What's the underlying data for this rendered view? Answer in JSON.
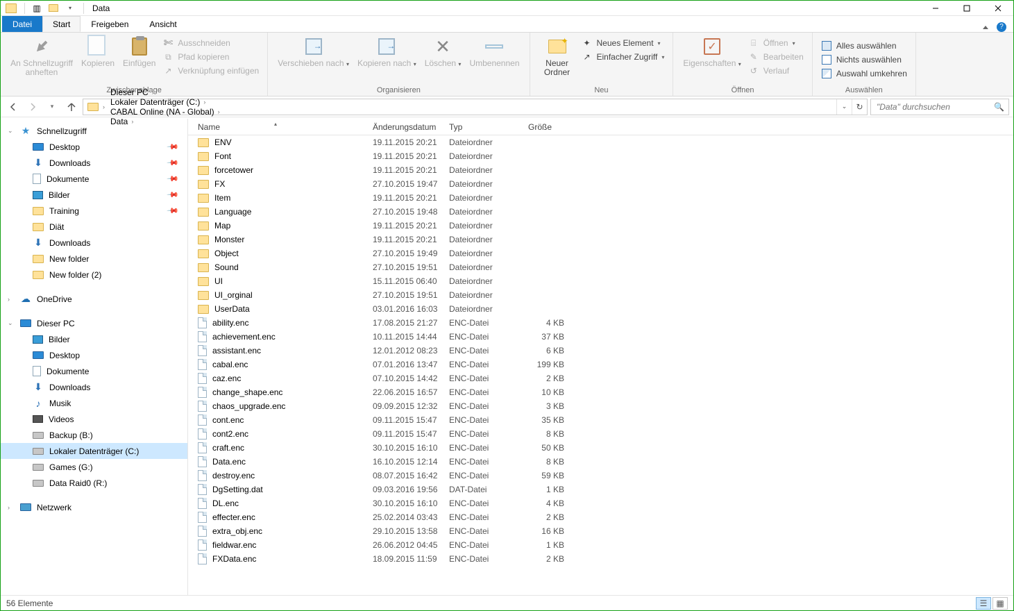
{
  "window": {
    "title": "Data"
  },
  "tabs": {
    "datei": "Datei",
    "start": "Start",
    "freigeben": "Freigeben",
    "ansicht": "Ansicht"
  },
  "ribbon": {
    "clipboard": {
      "pin": "An Schnellzugriff anheften",
      "copy": "Kopieren",
      "paste": "Einfügen",
      "cut": "Ausschneiden",
      "copypath": "Pfad kopieren",
      "pastelink": "Verknüpfung einfügen",
      "group": "Zwischenablage"
    },
    "organize": {
      "moveto": "Verschieben nach",
      "copyto": "Kopieren nach",
      "delete": "Löschen",
      "rename": "Umbenennen",
      "group": "Organisieren"
    },
    "new": {
      "newfolder": "Neuer Ordner",
      "newitem": "Neues Element",
      "easyaccess": "Einfacher Zugriff",
      "group": "Neu"
    },
    "open": {
      "properties": "Eigenschaften",
      "open": "Öffnen",
      "edit": "Bearbeiten",
      "history": "Verlauf",
      "group": "Öffnen"
    },
    "select": {
      "selectall": "Alles auswählen",
      "selectnone": "Nichts auswählen",
      "invert": "Auswahl umkehren",
      "group": "Auswählen"
    }
  },
  "breadcrumb": [
    "Dieser PC",
    "Lokaler Datenträger (C:)",
    "CABAL Online (NA - Global)",
    "Data"
  ],
  "search_placeholder": "\"Data\" durchsuchen",
  "nav": {
    "quickaccess": "Schnellzugriff",
    "qa_items": [
      {
        "label": "Desktop",
        "icon": "monitor",
        "pinned": true
      },
      {
        "label": "Downloads",
        "icon": "arrow-down",
        "pinned": true
      },
      {
        "label": "Dokumente",
        "icon": "doc",
        "pinned": true
      },
      {
        "label": "Bilder",
        "icon": "pic",
        "pinned": true
      },
      {
        "label": "Training",
        "icon": "folder",
        "pinned": true
      },
      {
        "label": "Diät",
        "icon": "folder",
        "pinned": false
      },
      {
        "label": "Downloads",
        "icon": "arrow-down",
        "pinned": false
      },
      {
        "label": "New folder",
        "icon": "folder",
        "pinned": false
      },
      {
        "label": "New folder (2)",
        "icon": "folder",
        "pinned": false
      }
    ],
    "onedrive": "OneDrive",
    "thispc": "Dieser PC",
    "pc_items": [
      {
        "label": "Bilder",
        "icon": "pic"
      },
      {
        "label": "Desktop",
        "icon": "monitor"
      },
      {
        "label": "Dokumente",
        "icon": "doc"
      },
      {
        "label": "Downloads",
        "icon": "arrow-down"
      },
      {
        "label": "Musik",
        "icon": "music"
      },
      {
        "label": "Videos",
        "icon": "video"
      },
      {
        "label": "Backup (B:)",
        "icon": "drive"
      },
      {
        "label": "Lokaler Datenträger (C:)",
        "icon": "drive",
        "selected": true
      },
      {
        "label": "Games (G:)",
        "icon": "drive"
      },
      {
        "label": "Data Raid0 (R:)",
        "icon": "drive"
      }
    ],
    "network": "Netzwerk"
  },
  "columns": {
    "name": "Name",
    "date": "Änderungsdatum",
    "type": "Typ",
    "size": "Größe"
  },
  "files": [
    {
      "name": "ENV",
      "date": "19.11.2015 20:21",
      "type": "Dateiordner",
      "size": "",
      "kind": "folder"
    },
    {
      "name": "Font",
      "date": "19.11.2015 20:21",
      "type": "Dateiordner",
      "size": "",
      "kind": "folder"
    },
    {
      "name": "forcetower",
      "date": "19.11.2015 20:21",
      "type": "Dateiordner",
      "size": "",
      "kind": "folder"
    },
    {
      "name": "FX",
      "date": "27.10.2015 19:47",
      "type": "Dateiordner",
      "size": "",
      "kind": "folder"
    },
    {
      "name": "Item",
      "date": "19.11.2015 20:21",
      "type": "Dateiordner",
      "size": "",
      "kind": "folder"
    },
    {
      "name": "Language",
      "date": "27.10.2015 19:48",
      "type": "Dateiordner",
      "size": "",
      "kind": "folder"
    },
    {
      "name": "Map",
      "date": "19.11.2015 20:21",
      "type": "Dateiordner",
      "size": "",
      "kind": "folder"
    },
    {
      "name": "Monster",
      "date": "19.11.2015 20:21",
      "type": "Dateiordner",
      "size": "",
      "kind": "folder"
    },
    {
      "name": "Object",
      "date": "27.10.2015 19:49",
      "type": "Dateiordner",
      "size": "",
      "kind": "folder"
    },
    {
      "name": "Sound",
      "date": "27.10.2015 19:51",
      "type": "Dateiordner",
      "size": "",
      "kind": "folder"
    },
    {
      "name": "UI",
      "date": "15.11.2015 06:40",
      "type": "Dateiordner",
      "size": "",
      "kind": "folder"
    },
    {
      "name": "UI_orginal",
      "date": "27.10.2015 19:51",
      "type": "Dateiordner",
      "size": "",
      "kind": "folder"
    },
    {
      "name": "UserData",
      "date": "03.01.2016 16:03",
      "type": "Dateiordner",
      "size": "",
      "kind": "folder"
    },
    {
      "name": "ability.enc",
      "date": "17.08.2015 21:27",
      "type": "ENC-Datei",
      "size": "4 KB",
      "kind": "file"
    },
    {
      "name": "achievement.enc",
      "date": "10.11.2015 14:44",
      "type": "ENC-Datei",
      "size": "37 KB",
      "kind": "file"
    },
    {
      "name": "assistant.enc",
      "date": "12.01.2012 08:23",
      "type": "ENC-Datei",
      "size": "6 KB",
      "kind": "file"
    },
    {
      "name": "cabal.enc",
      "date": "07.01.2016 13:47",
      "type": "ENC-Datei",
      "size": "199 KB",
      "kind": "file"
    },
    {
      "name": "caz.enc",
      "date": "07.10.2015 14:42",
      "type": "ENC-Datei",
      "size": "2 KB",
      "kind": "file"
    },
    {
      "name": "change_shape.enc",
      "date": "22.06.2015 16:57",
      "type": "ENC-Datei",
      "size": "10 KB",
      "kind": "file"
    },
    {
      "name": "chaos_upgrade.enc",
      "date": "09.09.2015 12:32",
      "type": "ENC-Datei",
      "size": "3 KB",
      "kind": "file"
    },
    {
      "name": "cont.enc",
      "date": "09.11.2015 15:47",
      "type": "ENC-Datei",
      "size": "35 KB",
      "kind": "file"
    },
    {
      "name": "cont2.enc",
      "date": "09.11.2015 15:47",
      "type": "ENC-Datei",
      "size": "8 KB",
      "kind": "file"
    },
    {
      "name": "craft.enc",
      "date": "30.10.2015 16:10",
      "type": "ENC-Datei",
      "size": "50 KB",
      "kind": "file"
    },
    {
      "name": "Data.enc",
      "date": "16.10.2015 12:14",
      "type": "ENC-Datei",
      "size": "8 KB",
      "kind": "file"
    },
    {
      "name": "destroy.enc",
      "date": "08.07.2015 16:42",
      "type": "ENC-Datei",
      "size": "59 KB",
      "kind": "file"
    },
    {
      "name": "DgSetting.dat",
      "date": "09.03.2016 19:56",
      "type": "DAT-Datei",
      "size": "1 KB",
      "kind": "file"
    },
    {
      "name": "DL.enc",
      "date": "30.10.2015 16:10",
      "type": "ENC-Datei",
      "size": "4 KB",
      "kind": "file"
    },
    {
      "name": "effecter.enc",
      "date": "25.02.2014 03:43",
      "type": "ENC-Datei",
      "size": "2 KB",
      "kind": "file"
    },
    {
      "name": "extra_obj.enc",
      "date": "29.10.2015 13:58",
      "type": "ENC-Datei",
      "size": "16 KB",
      "kind": "file"
    },
    {
      "name": "fieldwar.enc",
      "date": "26.06.2012 04:45",
      "type": "ENC-Datei",
      "size": "1 KB",
      "kind": "file"
    },
    {
      "name": "FXData.enc",
      "date": "18.09.2015 11:59",
      "type": "ENC-Datei",
      "size": "2 KB",
      "kind": "file"
    }
  ],
  "status": {
    "count": "56 Elemente"
  }
}
